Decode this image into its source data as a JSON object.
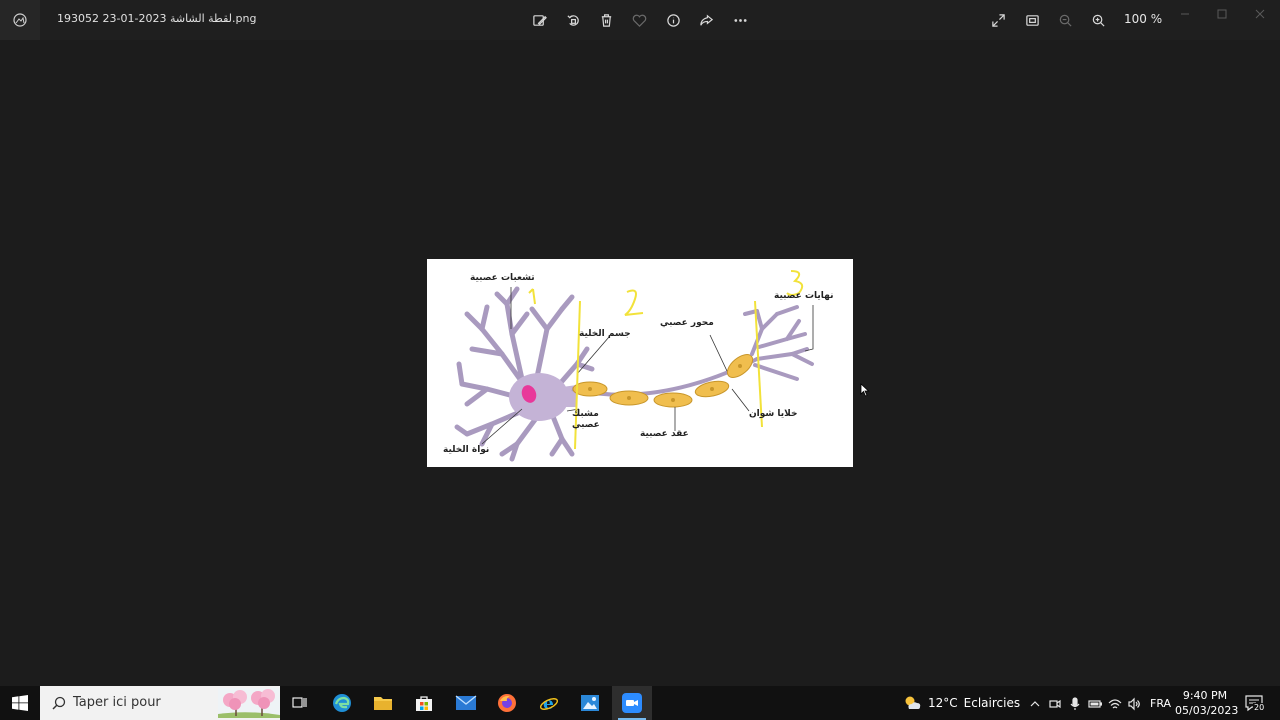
{
  "window": {
    "title": "لقطة الشاشة 2023-01-23 193052.png",
    "zoom_level": "100 %"
  },
  "toolbar": {
    "icons": [
      "edit-image-icon",
      "rotate-icon",
      "delete-icon",
      "favorite-icon",
      "info-icon",
      "share-icon",
      "more-icon"
    ],
    "right_icons": [
      "fullscreen-icon",
      "fit-icon",
      "zoom-out-icon",
      "zoom-in-icon"
    ]
  },
  "diagram": {
    "labels": {
      "dendrites": "تشعبات عصبية",
      "cell_body": "جسم الخلية",
      "axon": "محور عصبي",
      "terminals": "نهايات عصبية",
      "synapse_1": "مشبك",
      "synapse_2": "عصبي",
      "schwann": "خلايا شوان",
      "ganglia": "عقد عصبية",
      "nucleus": "نواة الخلية"
    },
    "handwritten": [
      "1",
      "2",
      "3"
    ],
    "colors": {
      "cell": "#c4b3d6",
      "nucleus": "#e8389a",
      "myelin": "#f0be4e",
      "annotation": "#f2e23a"
    }
  },
  "taskbar": {
    "search_placeholder": "Taper ici pour",
    "apps": [
      "task-view",
      "edge",
      "file-explorer",
      "store",
      "mail",
      "firefox",
      "internet-explorer",
      "photos",
      "zoom"
    ],
    "weather": {
      "temp": "12°C",
      "condition": "Eclaircies"
    },
    "language": "FRA",
    "time": "9:40 PM",
    "date": "05/03/2023",
    "notifications": "20"
  }
}
